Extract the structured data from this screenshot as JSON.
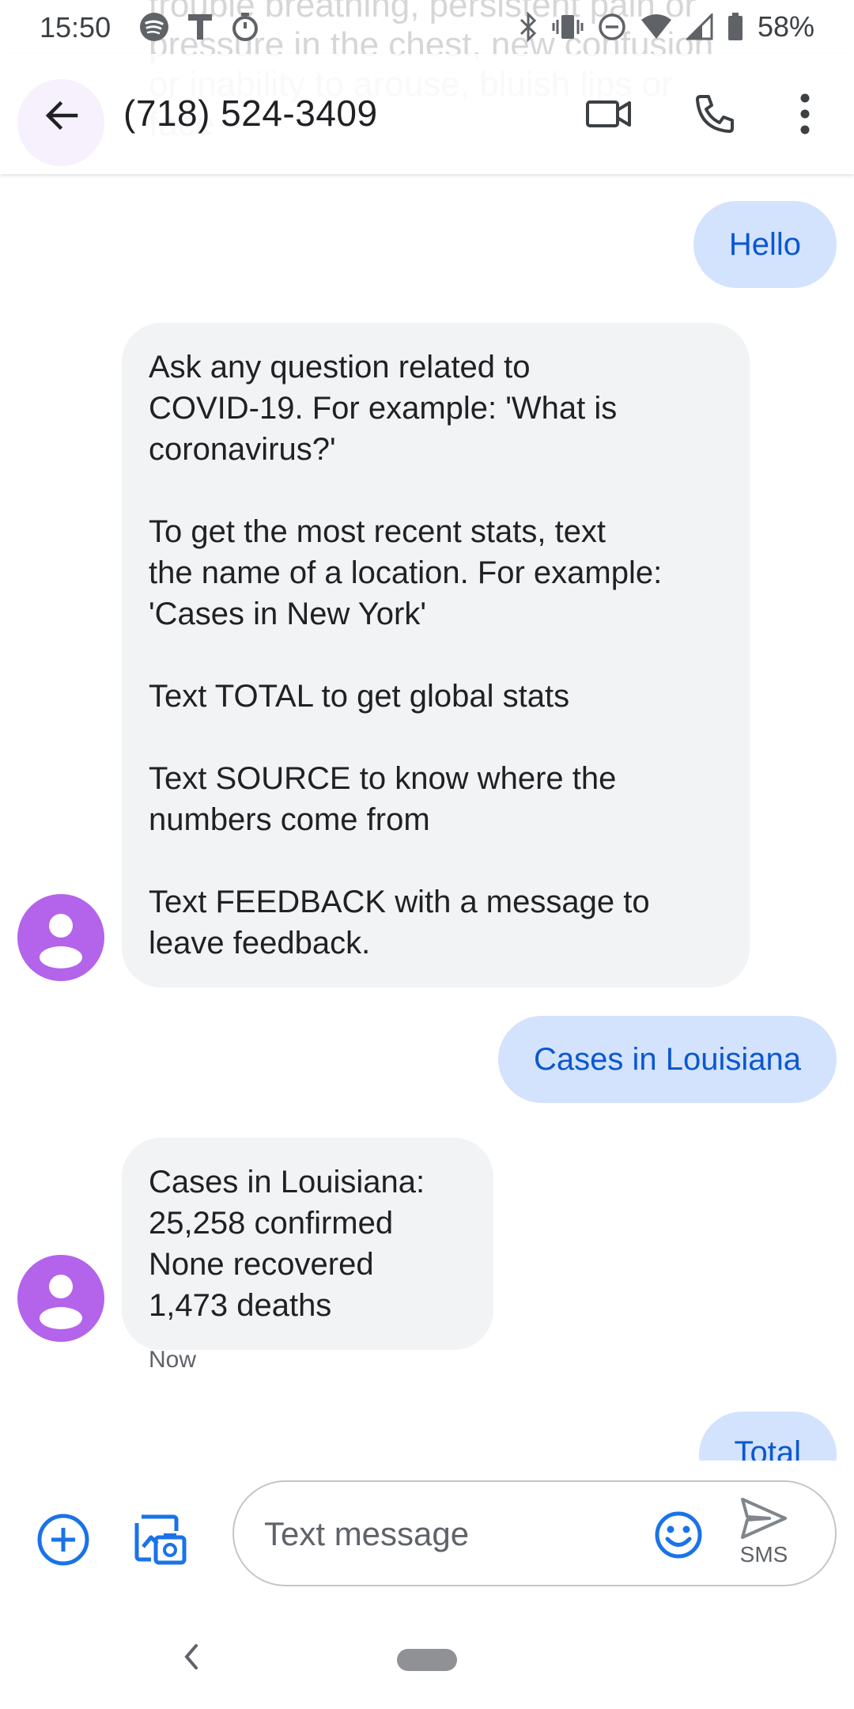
{
  "status_bar": {
    "time": "15:50",
    "battery": "58%",
    "left_icons": [
      "spotify-icon",
      "t-notification-icon",
      "timer-icon"
    ],
    "right_icons": [
      "bluetooth-icon",
      "vibrate-icon",
      "dnd-icon",
      "wifi-icon",
      "cell-signal-icon",
      "battery-icon"
    ]
  },
  "background_text": "trouble breathing, persistent pain or\npressure in the chest, new confusion\nor inability to arouse, bluish lips or\nface",
  "app_bar": {
    "contact": "(718) 524-3409",
    "actions": [
      "video-call-icon",
      "phone-call-icon",
      "more-options-icon"
    ]
  },
  "messages": [
    {
      "direction": "outgoing",
      "text": "Hello"
    },
    {
      "direction": "incoming",
      "text": "Ask any question related to\nCOVID-19. For example: 'What is\ncoronavirus?'\n\nTo get the most recent stats, text\nthe name of a location. For example:\n'Cases in New York'\n\nText TOTAL to get global stats\n\nText SOURCE to know where the\nnumbers come from\n\nText FEEDBACK with a message to\nleave feedback."
    },
    {
      "direction": "outgoing",
      "text": "Cases in Louisiana"
    },
    {
      "direction": "incoming",
      "text": "Cases in Louisiana:\n25,258 confirmed\nNone recovered\n1,473 deaths",
      "timestamp": "Now"
    },
    {
      "direction": "outgoing",
      "text": "Total"
    }
  ],
  "compose": {
    "placeholder": "Text message",
    "send_label": "SMS",
    "ghost_text": "Total"
  },
  "colors": {
    "outgoing_bubble": "#d3e3fd",
    "outgoing_text": "#0b57d0",
    "incoming_bubble": "#f1f3f4",
    "avatar": "#b364ea",
    "accent": "#1a73e8"
  }
}
